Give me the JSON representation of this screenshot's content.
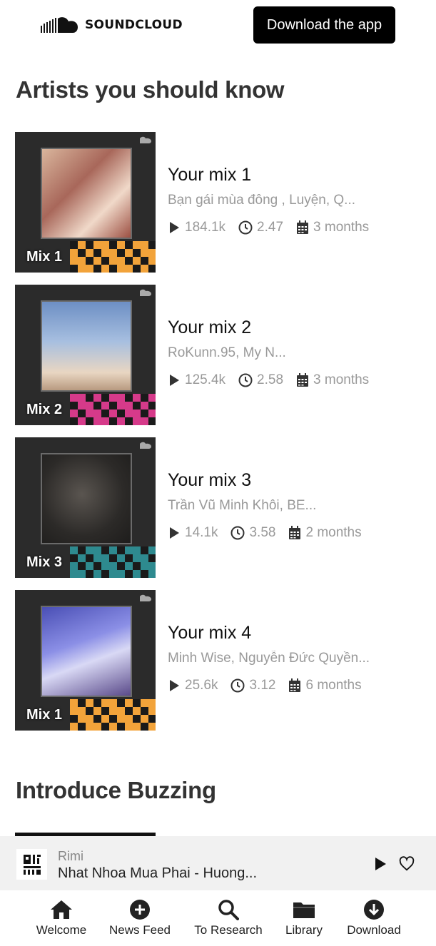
{
  "header": {
    "logo_text": "SOUNDCLOUD",
    "download_label": "Download the app"
  },
  "sections": {
    "artists_title": "Artists you should know",
    "buzzing_title": "Introduce Buzzing"
  },
  "mixes": [
    {
      "title": "Your mix 1",
      "artists": "Bạn gái mùa đông , Luyện, Q...",
      "plays": "184.1k",
      "duration": "2.47",
      "age": "3 months",
      "cover_label": "Mix 1",
      "accent": "#f2a33a"
    },
    {
      "title": "Your mix 2",
      "artists": "RoKunn.95, My N...",
      "plays": "125.4k",
      "duration": "2.58",
      "age": "3 months",
      "cover_label": "Mix 2",
      "accent": "#d63a8a"
    },
    {
      "title": "Your mix 3",
      "artists": "Trần Vũ Minh Khôi, BE...",
      "plays": "14.1k",
      "duration": "3.58",
      "age": "2 months",
      "cover_label": "Mix 3",
      "accent": "#2e8a8f"
    },
    {
      "title": "Your mix 4",
      "artists": "Minh Wise, Nguyễn Đức Quyền...",
      "plays": "25.6k",
      "duration": "3.12",
      "age": "6 months",
      "cover_label": "Mix 1",
      "accent": "#f2a33a"
    }
  ],
  "player": {
    "artist": "Rimi",
    "track": "Nhat Nhoa Mua Phai - Huong..."
  },
  "nav": [
    {
      "label": "Welcome",
      "icon": "home-icon"
    },
    {
      "label": "News Feed",
      "icon": "plus-circle-icon"
    },
    {
      "label": "To Research",
      "icon": "search-icon"
    },
    {
      "label": "Library",
      "icon": "folder-icon"
    },
    {
      "label": "Download",
      "icon": "download-circle-icon"
    }
  ]
}
